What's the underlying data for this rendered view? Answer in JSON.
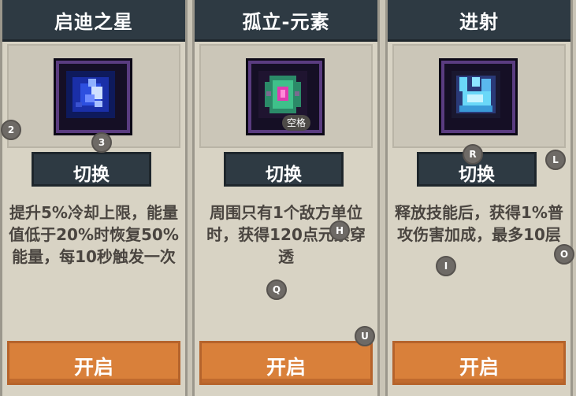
{
  "cards": [
    {
      "title": "启迪之星",
      "switch_label": "切换",
      "description": "提升5%冷却上限，能量值低于20%时恢复50%能量，每10秒触发一次",
      "open_label": "开启",
      "icon": "blue-star-gem-icon"
    },
    {
      "title": "孤立-元素",
      "switch_label": "切换",
      "description": "周围只有1个敌方单位时，获得120点元素穿透",
      "open_label": "开启",
      "icon": "green-element-gem-icon"
    },
    {
      "title": "进射",
      "switch_label": "切换",
      "description": "释放技能后，获得1%普攻伤害加成，最多10层",
      "open_label": "开启",
      "icon": "cyan-burst-gem-icon"
    }
  ],
  "hotkeys": {
    "k2": "2",
    "k3": "3",
    "space": "空格",
    "h": "H",
    "q": "Q",
    "u": "U",
    "r": "R",
    "l": "L",
    "i": "I",
    "o": "O"
  },
  "colors": {
    "header": "#2e3a43",
    "card_bg": "#d8d3c4",
    "open_button": "#d9803a",
    "text": "#4a4540"
  }
}
